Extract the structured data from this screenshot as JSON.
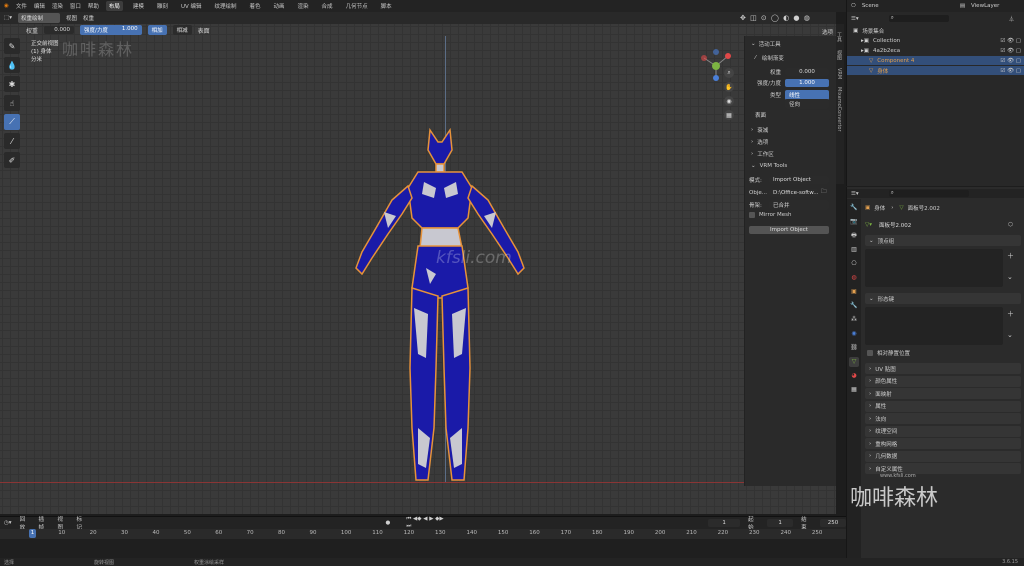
{
  "topbar": {
    "menus": [
      "文件",
      "编辑",
      "渲染",
      "窗口",
      "帮助"
    ],
    "workspaces": [
      "布局",
      "建模",
      "雕刻",
      "UV 编辑",
      "纹理绘制",
      "着色",
      "动画",
      "渲染",
      "合成",
      "几何节点",
      "脚本"
    ],
    "active_workspace": "布局"
  },
  "viewport_header": {
    "mode": "权重绘制",
    "menus": [
      "视图",
      "权重"
    ],
    "shading_label": "选项"
  },
  "tool_options": {
    "weight_label": "权重",
    "weight_value": "0.000",
    "strength_label": "强度/力度",
    "strength_value": "1.000",
    "add_label": "相加",
    "subtract_label": "相减",
    "falloff_label": "表面"
  },
  "viewport_info": {
    "line1": "正交前视图",
    "line2": "(1) 身体",
    "line3": "分米"
  },
  "watermark_top": "咖啡森林",
  "watermark_center": "kfsli.com",
  "npanel": {
    "active_tool_label": "活动工具",
    "brush_name": "绘制渐变",
    "weight_label": "权重",
    "weight_value": "0.000",
    "strength_label": "强度/力度",
    "strength_value": "1.000",
    "type_label": "类型",
    "type_linear": "线性",
    "type_radial": "径向",
    "falloff_value": "表面",
    "sections": [
      "衰减",
      "选项",
      "工作区"
    ],
    "vrm_title": "VRM Tools",
    "mode_label": "模式:",
    "mode_value": "Import Object",
    "obj_label": "Obje...",
    "obj_path": "D:\\Office-softw...",
    "skel_label": "骨架:",
    "skel_value": "已合并",
    "mirror_label": "Mirror Mesh",
    "import_btn": "Import Object",
    "tabs": [
      "工具",
      "视图",
      "VRM",
      "MixamoConvertor"
    ]
  },
  "outliner": {
    "scene_label": "Scene",
    "view_layer": "ViewLayer",
    "rows": [
      {
        "name": "场景集合",
        "indent": 0,
        "color": "#cfcfcf"
      },
      {
        "name": "Collection",
        "indent": 1,
        "color": "#cfcfcf"
      },
      {
        "name": "4a2b2eca",
        "indent": 1,
        "color": "#cfcfcf"
      },
      {
        "name": "Component 4",
        "indent": 2,
        "color": "#e3a04f"
      },
      {
        "name": "身体",
        "indent": 2,
        "color": "#e3a04f"
      }
    ]
  },
  "properties": {
    "object_path": "身体",
    "mesh_name": "面板号2.002",
    "mesh_field": "面板号2.002",
    "sections": [
      "顶点组",
      "形态键"
    ],
    "relative_label": "相对静置位置",
    "panels": [
      "UV 贴图",
      "颜色属性",
      "面映射",
      "属性",
      "法向",
      "纹理空间",
      "重构网格",
      "几何数据",
      "自定义属性"
    ]
  },
  "timeline": {
    "menus": [
      "回放",
      "插帧",
      "视图",
      "标记"
    ],
    "current_frame": "1",
    "start_label": "起始",
    "start_value": "1",
    "end_label": "结束",
    "end_value": "250",
    "ticks": [
      "1",
      "10",
      "20",
      "30",
      "40",
      "50",
      "60",
      "70",
      "80",
      "90",
      "100",
      "110",
      "120",
      "130",
      "140",
      "150",
      "160",
      "170",
      "180",
      "190",
      "200",
      "210",
      "220",
      "230",
      "240",
      "250"
    ]
  },
  "statusbar": {
    "select": "选择",
    "rotate_view": "旋转视图",
    "sample": "权重涂绘采样",
    "version": "3.6.15"
  },
  "bottom_watermark": "咖啡森林",
  "bottom_watermark_small": "www.kfsli.com",
  "colors": {
    "accent": "#4772b3",
    "mesh": "#1a1aa8",
    "selection": "#e6923a"
  }
}
